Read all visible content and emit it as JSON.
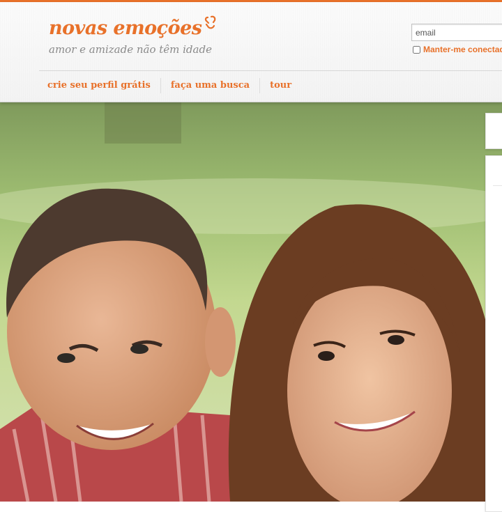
{
  "header": {
    "logo_text": "novas emoções",
    "tagline": "amor e amizade não têm idade",
    "brand_color": "#e8712a"
  },
  "login": {
    "email_placeholder": "email",
    "remember_label": "Manter-me conectado"
  },
  "nav": {
    "items": [
      {
        "label": "crie seu perfil grátis"
      },
      {
        "label": "faça uma busca"
      },
      {
        "label": "tour"
      }
    ]
  },
  "hero": {
    "image_subject": "smiling couple photo"
  }
}
